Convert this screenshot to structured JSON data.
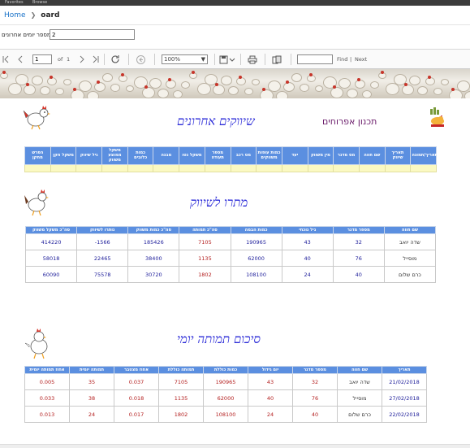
{
  "topbar": {
    "left1": "Favorites",
    "left2": "Browse"
  },
  "breadcrumb": {
    "home": "Home",
    "current": "oard"
  },
  "params": {
    "label": "מספר יומים אחרונים",
    "value": "2"
  },
  "toolbar": {
    "page_value": "1",
    "of_label": "of",
    "total_pages": "1",
    "zoom_value": "100%",
    "find_label": "Find",
    "divider": "|",
    "next_label": "Next"
  },
  "report": {
    "section1_title": "שיווקים אחרונים",
    "brand_title": "תכנון אפרוחים",
    "table1": {
      "headers": [
        "תאריך/תמונה",
        "תאריך שיווק",
        "שם חווה",
        "מס מדגר",
        "מין משווק",
        "יעד",
        "כמות עופות משווקים",
        "מס רכב",
        "מספר תעודה",
        "משקל נטו",
        "מבנה",
        "כמות כלובים",
        "משקל ממוצע משווק",
        "גיל שיווק",
        "משקל חקן",
        "הפרש מחקן"
      ]
    },
    "section2_title": "מתרו לשיווק",
    "table2": {
      "headers": [
        "שם חווה",
        "מספר מדגר",
        "גיל נוכחי",
        "כמות הבמה",
        "סה\"כ תמותה",
        "סה\"כ כמות משווק",
        "נותרו לשיווק",
        "סה\"כ משקל משווק"
      ],
      "rows": [
        [
          "שדה יואב",
          "32",
          "43",
          "190965",
          "7105",
          "185426",
          "-1566",
          "414220"
        ],
        [
          "מוסייל",
          "76",
          "40",
          "62000",
          "1135",
          "38400",
          "22465",
          "58018"
        ],
        [
          "כרם שלום",
          "40",
          "24",
          "108100",
          "1802",
          "30720",
          "75578",
          "60090"
        ]
      ]
    },
    "section3_title": "סיכום תמותה יומי",
    "table3": {
      "headers": [
        "תאריך",
        "שם חווה",
        "מספר מדגר",
        "יום גידול",
        "כמות כוללת",
        "תמותה כוללת",
        "אחוז מצטבר",
        "תמותה יומית",
        "אחוז תמותה יומית"
      ],
      "rows": [
        [
          "21/02/2018",
          "שדה יואב",
          "32",
          "43",
          "190965",
          "7105",
          "0.037",
          "35",
          "0.005"
        ],
        [
          "27/02/2018",
          "מוסייל",
          "76",
          "40",
          "62000",
          "1135",
          "0.018",
          "38",
          "0.033"
        ],
        [
          "22/02/2018",
          "כרם שלום",
          "40",
          "24",
          "108100",
          "1802",
          "0.017",
          "24",
          "0.013"
        ]
      ]
    }
  }
}
